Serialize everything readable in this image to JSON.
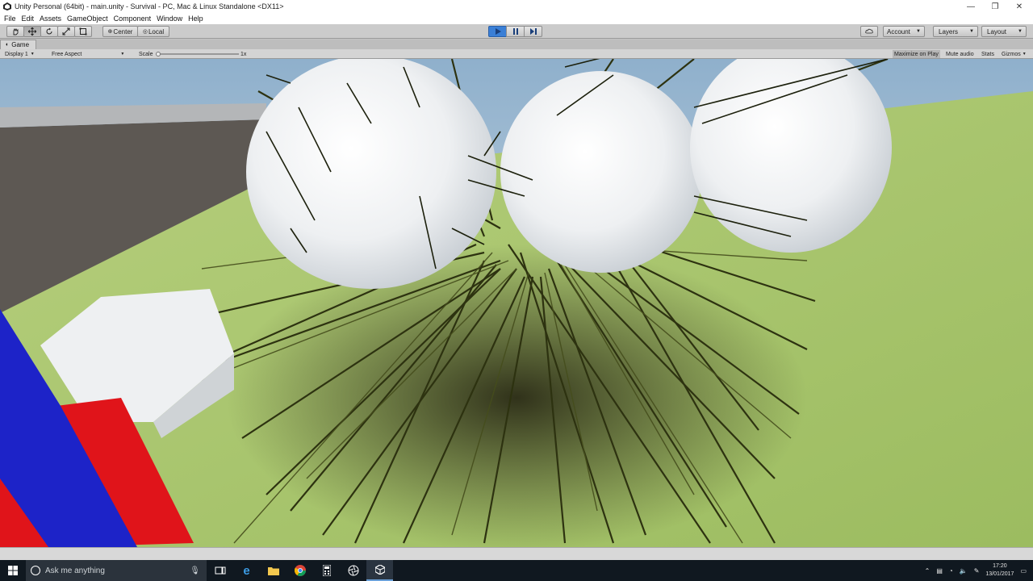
{
  "window": {
    "title": "Unity Personal (64bit) - main.unity - Survival - PC, Mac & Linux Standalone <DX11>",
    "controls": [
      "minimize-icon",
      "restore-icon",
      "close-icon"
    ]
  },
  "menu": [
    "File",
    "Edit",
    "Assets",
    "GameObject",
    "Component",
    "Window",
    "Help"
  ],
  "toolbar": {
    "tools": [
      "hand-icon",
      "move-icon",
      "rotate-icon",
      "scale-icon",
      "rect-icon"
    ],
    "pivot_label": "Center",
    "space_label": "Local",
    "account_label": "Account",
    "layers_label": "Layers",
    "layout_label": "Layout",
    "playing": true
  },
  "game_view": {
    "tab_label": "Game",
    "display": "Display 1",
    "aspect": "Free Aspect",
    "scale_label": "Scale",
    "scale_value": "1x",
    "maximize_on_play": "Maximize on Play",
    "mute_audio": "Mute audio",
    "stats": "Stats",
    "gizmos": "Gizmos"
  },
  "taskbar": {
    "search_placeholder": "Ask me anything",
    "time": "17:20",
    "date": "13/01/2017"
  },
  "colors": {
    "play_active": "#3a7fd6",
    "sky": "#a9c3da",
    "ground": "#a4c46a",
    "taskbar": "#101820"
  }
}
